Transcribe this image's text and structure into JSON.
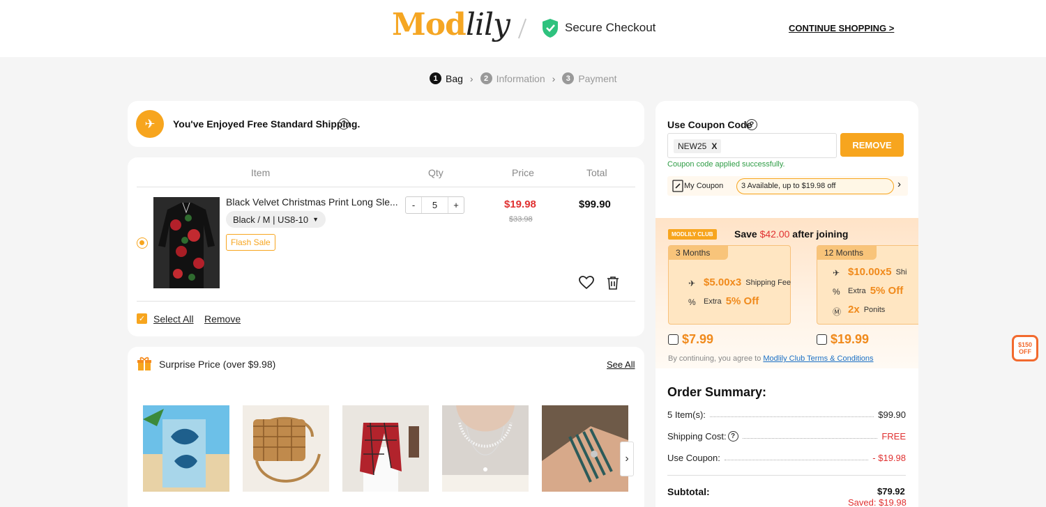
{
  "header": {
    "logo_part1": "Mod",
    "logo_part2": "lily",
    "secure_text": "Secure Checkout",
    "continue_shopping": "CONTINUE SHOPPING >"
  },
  "steps": [
    {
      "num": "1",
      "label": "Bag",
      "active": true
    },
    {
      "num": "2",
      "label": "Information",
      "active": false
    },
    {
      "num": "3",
      "label": "Payment",
      "active": false
    }
  ],
  "shipping": {
    "text": "You've Enjoyed Free Standard Shipping.",
    "help": "?"
  },
  "cart": {
    "headers": {
      "item": "Item",
      "qty": "Qty",
      "price": "Price",
      "total": "Total"
    },
    "item": {
      "title": "Black Velvet Christmas Print Long Sle...",
      "variant": "Black / M | US8-10",
      "tag": "Flash Sale",
      "qty_minus": "-",
      "qty": "5",
      "qty_plus": "+",
      "price": "$19.98",
      "old_price": "$33.98",
      "total": "$99.90"
    },
    "select_all": "Select All",
    "remove": "Remove"
  },
  "surprise": {
    "title": "Surprise Price (over $9.98)",
    "see_all": "See All",
    "next": "›"
  },
  "coupon": {
    "label": "Use Coupon Code",
    "help": "?",
    "code": "NEW25",
    "code_clear": "X",
    "remove_btn": "REMOVE",
    "success": "Coupon code applied successfully.",
    "my_coupon": "My Coupon",
    "available": "3 Available, up to $19.98 off",
    "arrow": "›"
  },
  "club": {
    "badge": "MODLILY CLUB",
    "save_prefix": "Save ",
    "save_amount": "$42.00",
    "save_suffix": " after joining",
    "plans": [
      {
        "name": "3 Months",
        "line1_big": "$5.00x3",
        "line1_small": "Shipping Fee",
        "line2_small": "Extra",
        "line2_big": "5% Off",
        "price": "$7.99"
      },
      {
        "name": "12 Months",
        "line1_big": "$10.00x5",
        "line1_small": "Shi",
        "line2_small": "Extra",
        "line2_big": "5% Off",
        "line3_big": "2x",
        "line3_small": "Ponits",
        "price": "$19.99"
      }
    ],
    "terms_prefix": "By continuing, you agree to ",
    "terms_link": "Modlily Club Terms & Conditions"
  },
  "summary": {
    "title": "Order Summary:",
    "items_label": "5 Item(s):",
    "items_value": "$99.90",
    "shipping_label": "Shipping Cost:",
    "shipping_value": "FREE",
    "coupon_label": "Use Coupon:",
    "coupon_value": "- $19.98",
    "subtotal_label": "Subtotal:",
    "subtotal_value": "$79.92",
    "saved": "Saved: $19.98"
  },
  "float_badge": {
    "line1": "$150",
    "line2": "OFF"
  },
  "colors": {
    "accent": "#f7a51e",
    "price_red": "#e03131",
    "success": "#2e9c45"
  }
}
